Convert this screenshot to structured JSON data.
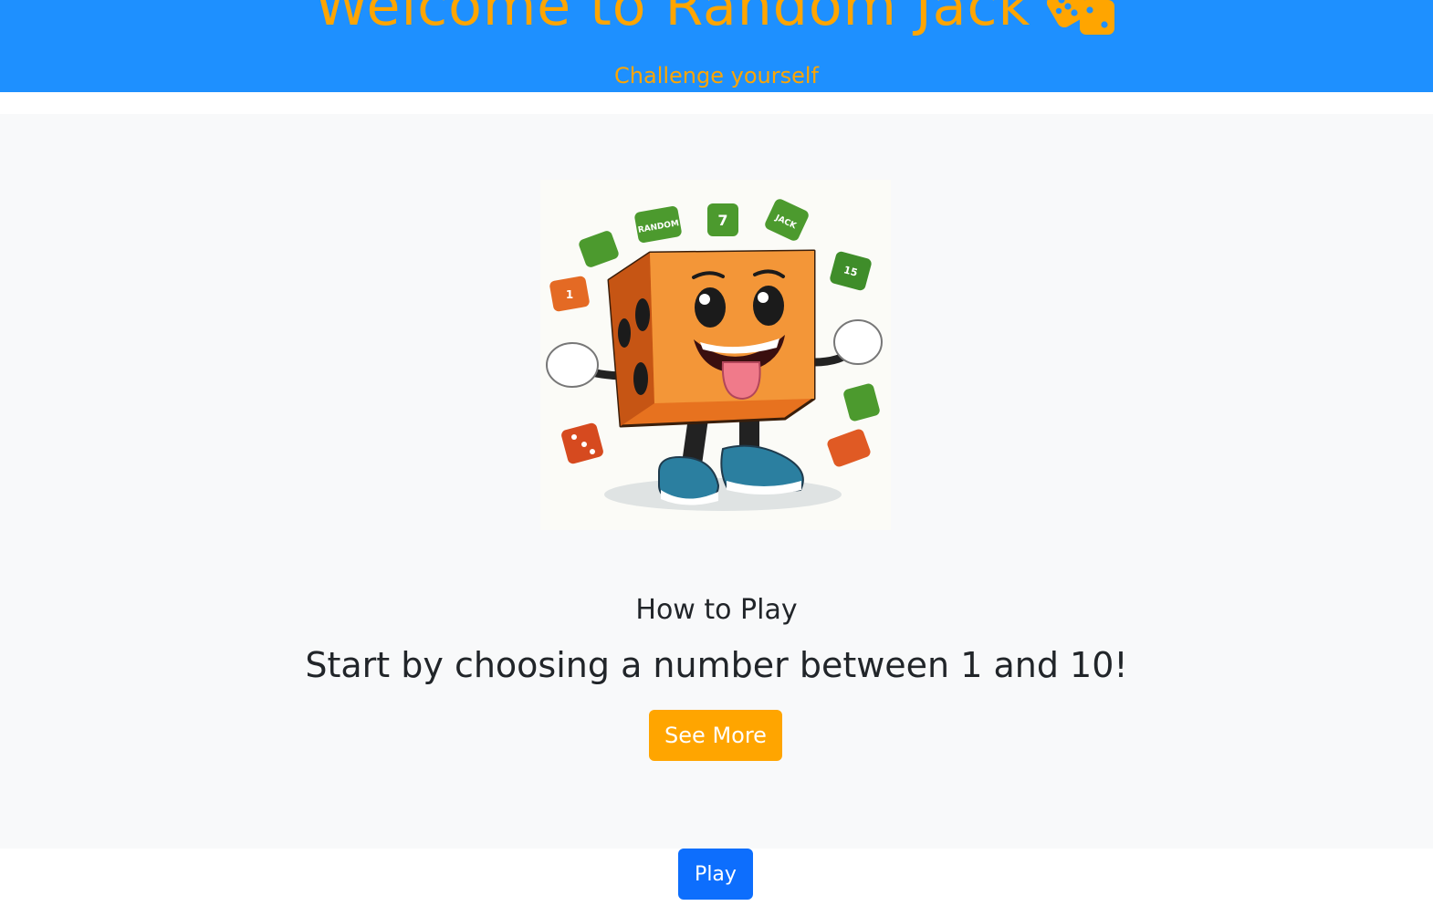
{
  "header": {
    "title": "Welcome to Random Jack",
    "title_icon": "dice-icon",
    "subtitle": "Challenge yourself"
  },
  "hero": {
    "image": "cartoon-dice-character-illustration",
    "dice_labels": [
      "RANDOM",
      "7",
      "JACK",
      "1",
      "15"
    ]
  },
  "how_to_play": {
    "heading": "How to Play",
    "instruction": "Start by choosing a number between 1 and 10!",
    "see_more_label": "See More"
  },
  "footer": {
    "play_label": "Play"
  },
  "colors": {
    "header_bg": "#1e90ff",
    "accent": "#ffa500",
    "main_bg": "#f8f9fa",
    "primary_button": "#0d6efd",
    "text": "#212529"
  }
}
